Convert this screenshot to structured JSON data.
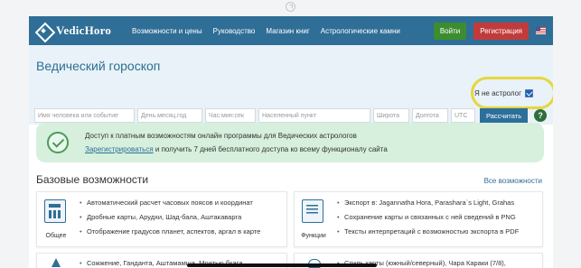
{
  "brand": {
    "name": "VedicHoro"
  },
  "nav": {
    "links": [
      "Возможности и цены",
      "Руководство",
      "Магазин книг",
      "Астрологические камни"
    ],
    "login": "Войти",
    "register": "Регистрация"
  },
  "hero": {
    "title": "Ведический гороскоп",
    "astrologer_label": "Я не астролог",
    "astrologer_checked": true,
    "fields": {
      "name": "Имя человека или событие",
      "date": "День.месяц.год",
      "time": "Час:мин:сек",
      "place": "Населенный пункт",
      "lat": "Широта",
      "lon": "Долгота",
      "utc": "UTC"
    },
    "calculate": "Рассчитать",
    "help": "?"
  },
  "notice": {
    "title": "Доступ к платным возможностям онлайн программы для Ведических астрологов",
    "link": "Зарегистрироваться",
    "rest": " и получить 7 дней бесплатного доступа ко всему функционалу сайта"
  },
  "features": {
    "title": "Базовые возможности",
    "all": "Все возможности",
    "cards": [
      {
        "caption": "Общее",
        "items": [
          "Автоматический расчет часовых поясов и координат",
          "Дробные карты, Арудхи, Шад-бала, Аштакаварга",
          "Отображение градусов планет, аспектов, аргал в карте"
        ]
      },
      {
        "caption": "Функции",
        "items": [
          "Экспорт в: Jagannatha Hora, Parashara`s Light, Grahas",
          "Сохранение карты и связанных с ней сведений в PNG",
          "Тексты интерпретаций с возможностью экспорта в PDF"
        ]
      },
      {
        "items": [
          "Сожжение, Ганданта, Аштамамша, Мритью бхага,"
        ]
      },
      {
        "items": [
          "Стиль карты (южный/северный), Чара Караки (7/8),"
        ]
      }
    ]
  }
}
